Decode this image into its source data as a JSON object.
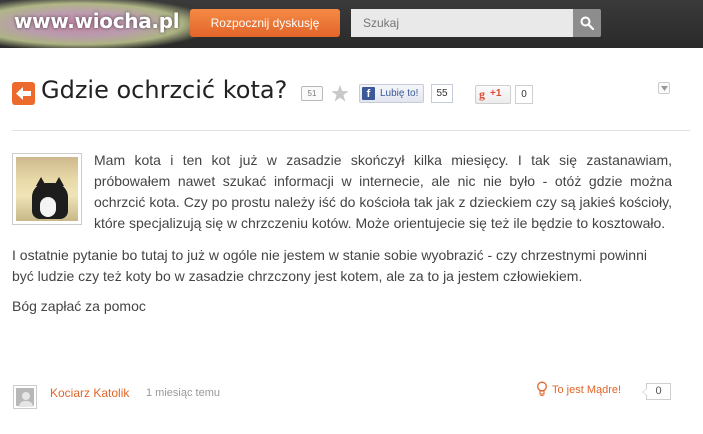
{
  "topbar": {
    "logo": "www.wiocha.pl",
    "start_discussion_label": "Rozpocznij dyskusję",
    "search_placeholder": "Szukaj"
  },
  "post": {
    "title": "Gdzie ochrzcić kota?",
    "comment_count": "51",
    "fb_like_label": "Lubię to!",
    "fb_like_count": "55",
    "gplus_label": "+1",
    "gplus_count": "0",
    "paragraphs": [
      "Mam kota i ten kot już w zasadzie skończył kilka miesięcy. I tak się zastanawiam, próbowałem nawet szukać informacji w internecie, ale nic nie było - otóż gdzie można ochrzcić kota. Czy po prostu należy iść do kościoła tak jak z dzieckiem czy są jakieś kościoły, które specjalizują się w chrzczeniu kotów. Może orientujecie się też ile będzie to kosztowało.",
      "I ostatnie pytanie bo tutaj to już w ogóle nie jestem w stanie sobie wyobrazić - czy chrzestnymi powinni być ludzie czy też koty bo w zasadzie chrzczony jest kotem, ale za to ja jestem człowiekiem.",
      "Bóg zapłać za pomoc"
    ]
  },
  "footer": {
    "author": "Kociarz Katolik",
    "time": "1 miesiąc temu",
    "wise_label": "To jest Mądre!",
    "wise_count": "0"
  },
  "colors": {
    "accent": "#e2652a",
    "topbar": "#333333",
    "facebook": "#3b5998",
    "gplus": "#dd4b39"
  },
  "icons": [
    "back-arrow-icon",
    "search-icon",
    "star-icon",
    "facebook-icon",
    "chevron-down-icon",
    "user-avatar-icon",
    "lightbulb-icon"
  ]
}
